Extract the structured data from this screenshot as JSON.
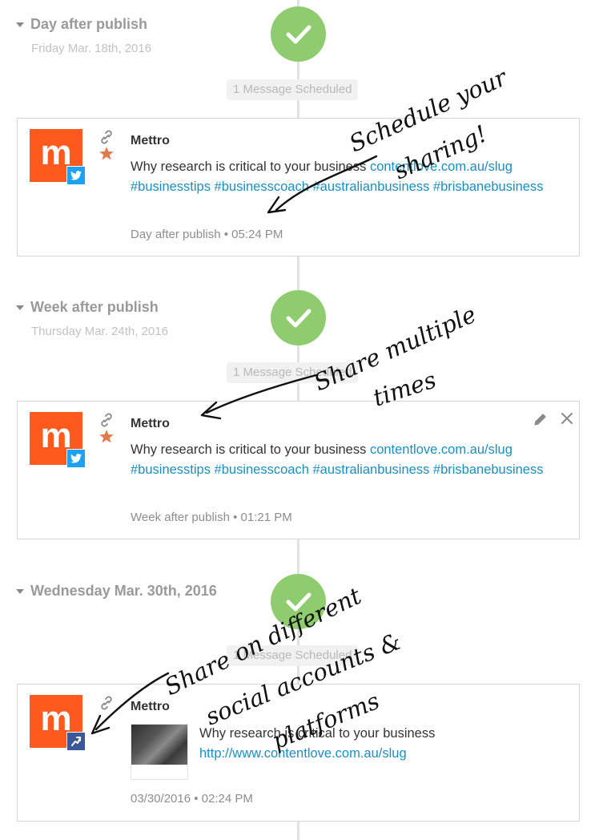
{
  "sections": [
    {
      "title": "Day after publish",
      "subtitle": "Friday Mar. 18th, 2016",
      "scheduled": "1 Message Scheduled",
      "post": {
        "author": "Mettro",
        "avatar_letter": "m",
        "network": "twitter",
        "text": "Why research is critical to your business ",
        "link": "contentlove.com.au/slug",
        "hashtags": "#businesstips #businesscoach #australianbusiness #brisbanebusiness",
        "meta": "Day after publish • 05:24 PM"
      }
    },
    {
      "title": "Week after publish",
      "subtitle": "Thursday Mar. 24th, 2016",
      "scheduled": "1 Message Scheduled",
      "post": {
        "author": "Mettro",
        "avatar_letter": "m",
        "network": "twitter",
        "text": "Why research is critical to your business ",
        "link": "contentlove.com.au/slug",
        "hashtags": "#businesstips #businesscoach #australianbusiness #brisbanebusiness",
        "meta": "Week after publish • 01:21 PM"
      }
    },
    {
      "title": "Wednesday Mar. 30th, 2016",
      "scheduled": "1 Message Scheduled",
      "post": {
        "author": "Mettro",
        "avatar_letter": "m",
        "network": "facebook",
        "text": "Why research is critical to your business",
        "link": "http://www.contentlove.com.au/slug",
        "meta": "03/30/2016 • 02:24 PM"
      }
    }
  ],
  "annotations": {
    "first": "Schedule your sharing!",
    "second": "Share multiple times",
    "third": "Share on different social accounts & platforms"
  },
  "colors": {
    "brand_orange": "#ff5a1e",
    "success_green": "#8fcc6f",
    "link_blue": "#1a8fbf",
    "twitter_blue": "#1da1f2",
    "facebook_blue": "#3b5998"
  }
}
